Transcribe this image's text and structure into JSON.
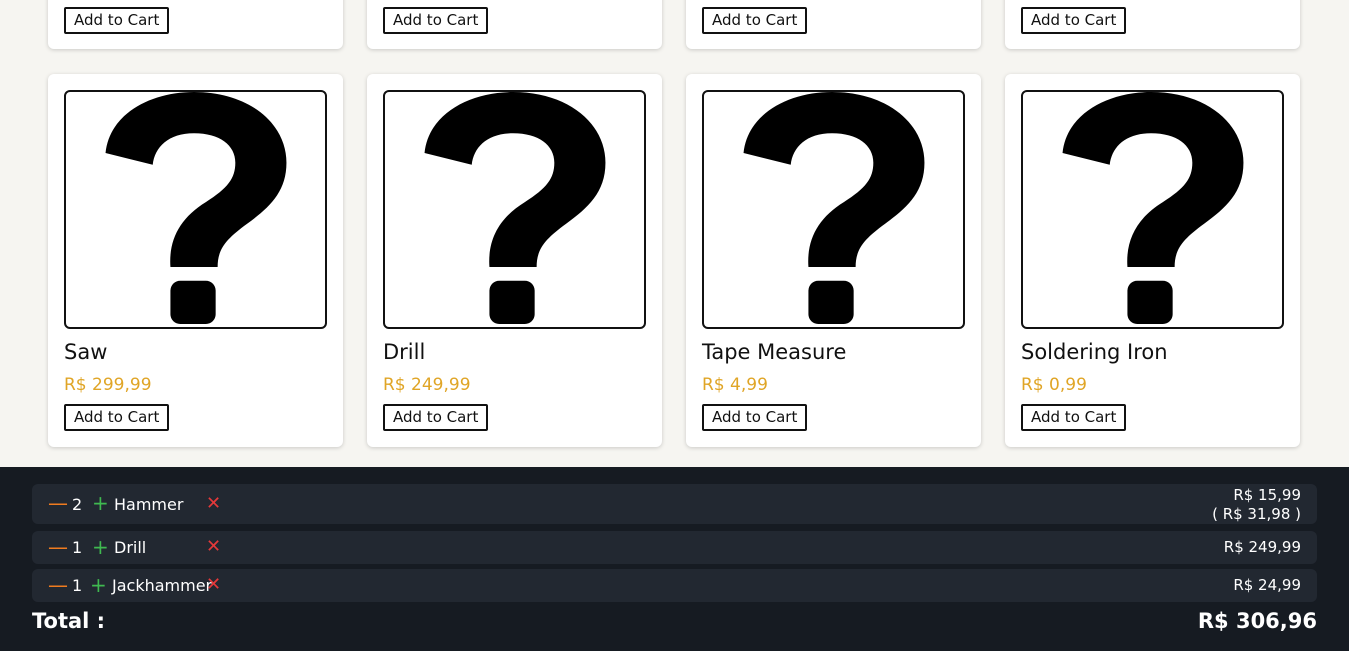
{
  "top_row": [
    {
      "button_label": "Add to Cart"
    },
    {
      "button_label": "Add to Cart"
    },
    {
      "button_label": "Add to Cart"
    },
    {
      "button_label": "Add to Cart"
    }
  ],
  "products": [
    {
      "name": "Saw",
      "price": "R$ 299,99",
      "button_label": "Add to Cart"
    },
    {
      "name": "Drill",
      "price": "R$ 249,99",
      "button_label": "Add to Cart"
    },
    {
      "name": "Tape Measure",
      "price": "R$ 4,99",
      "button_label": "Add to Cart"
    },
    {
      "name": "Soldering Iron",
      "price": "R$ 0,99",
      "button_label": "Add to Cart"
    }
  ],
  "cart": {
    "items": [
      {
        "minus": "—",
        "quantity": "2",
        "plus": "+",
        "name": "Hammer",
        "remove": "✕",
        "unit_price": "R$ 15,99",
        "line_total": "( R$ 31,98 )"
      },
      {
        "minus": "—",
        "quantity": "1",
        "plus": "+",
        "name": "Drill",
        "remove": "✕",
        "unit_price": "R$ 249,99"
      },
      {
        "minus": "—",
        "quantity": "1",
        "plus": "+",
        "name": "Jackhammer",
        "remove": "✕",
        "unit_price": "R$ 24,99"
      }
    ],
    "total_label": "Total :",
    "total_value": "R$ 306,96"
  },
  "colors": {
    "background": "#f6f5f1",
    "price": "#e0a526",
    "cart_background": "#161b22",
    "cart_row": "#222831",
    "minus": "#f07b1f",
    "plus": "#3fb950",
    "remove": "#e5393a"
  },
  "icons": {
    "product_placeholder": "question-mark-icon"
  }
}
